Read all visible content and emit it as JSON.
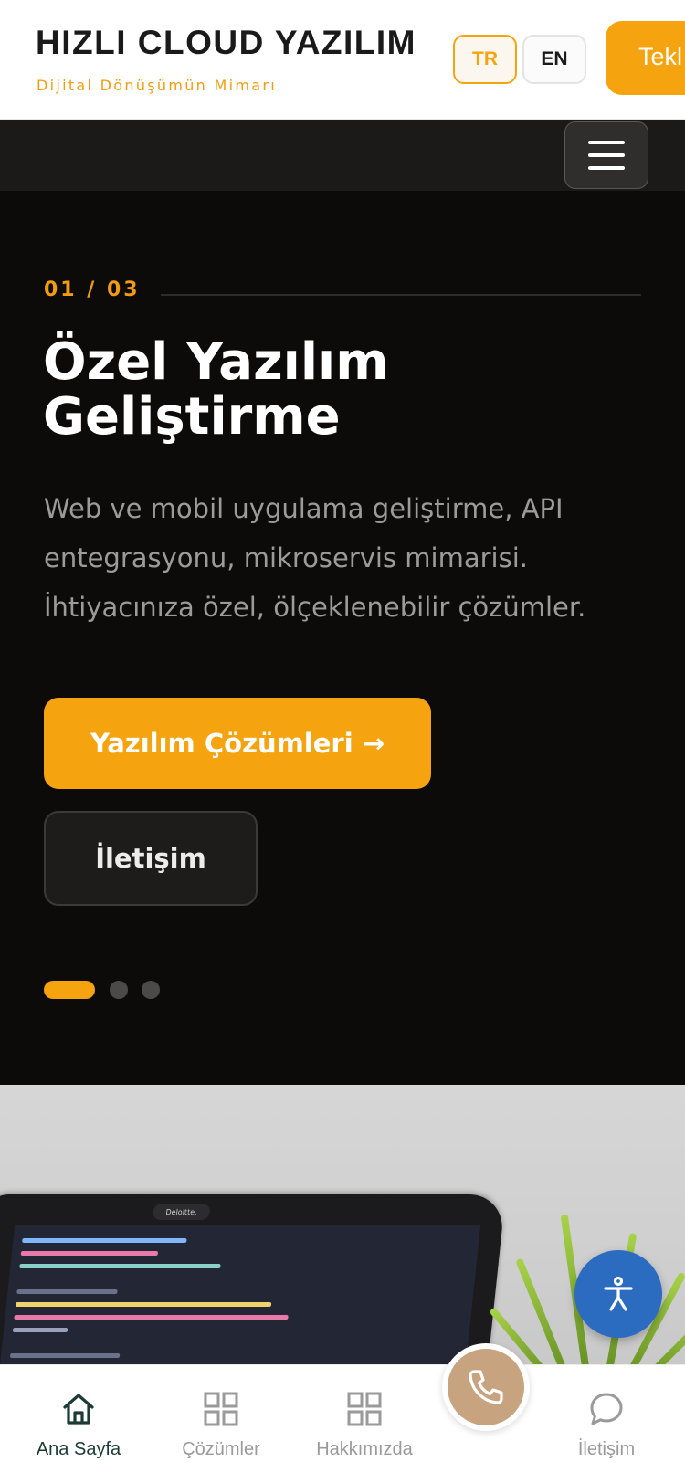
{
  "header": {
    "brand_title": "HIZLI CLOUD YAZILIM",
    "brand_subtitle": "Dijital Dönüşümün Mimarı",
    "lang_tr": "TR",
    "lang_en": "EN",
    "quote_button": "Tekl"
  },
  "hero": {
    "slide_counter": "01 / 03",
    "title": "Özel Yazılım Geliştirme",
    "description": "Web ve mobil uygulama geliştirme, API entegrasyonu, mikroservis mimarisi. İhtiyacınıza özel, ölçeklenebilir çözümler.",
    "primary_button": "Yazılım Çözümleri →",
    "secondary_button": "İletişim",
    "slides_total": 3,
    "active_slide": 1
  },
  "photo": {
    "laptop_sticker": "Deloitte.",
    "icon": "laptop-code-photo"
  },
  "bottom_nav": {
    "items": [
      {
        "label": "Ana Sayfa",
        "icon": "home-icon",
        "active": true
      },
      {
        "label": "Çözümler",
        "icon": "grid-icon",
        "active": false
      },
      {
        "label": "Hakkımızda",
        "icon": "grid-icon",
        "active": false
      },
      {
        "label": "İletişim",
        "icon": "chat-bubble-icon",
        "active": false
      }
    ],
    "call_icon": "phone-icon"
  },
  "colors": {
    "accent": "#f5a30f",
    "hero_bg": "#0d0b0a",
    "call_button": "#c8a380",
    "accessibility_button": "#2b6bc0",
    "active_nav": "#1d3b33"
  }
}
